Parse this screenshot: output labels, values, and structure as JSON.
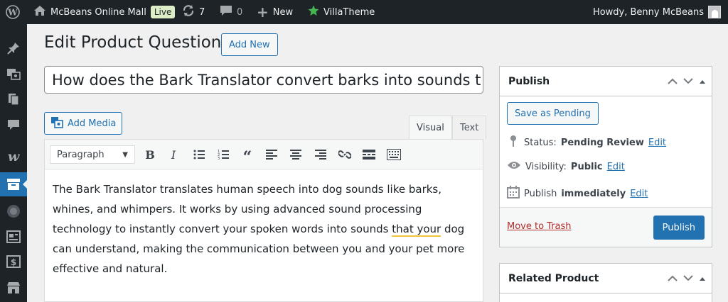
{
  "admin_bar": {
    "site_name": "McBeans Online Mall",
    "live_badge": "Live",
    "updates_count": "7",
    "comments_count": "0",
    "new_label": "New",
    "villatheme_label": "VillaTheme",
    "howdy": "Howdy, Benny McBeans"
  },
  "page": {
    "title": "Edit Product Question",
    "add_new_label": "Add New"
  },
  "post": {
    "title_value": "How does the Bark Translator convert barks into sounds t"
  },
  "editor": {
    "add_media_label": "Add Media",
    "tab_visual": "Visual",
    "tab_text": "Text",
    "format_value": "Paragraph",
    "content_part1": "The Bark Translator translates human speech into dog sounds like barks, whines, and whimpers. It works by using advanced sound processing technology to instantly convert your spoken words into sounds ",
    "content_spell": "that your",
    "content_part2": " dog can understand, making the communication between you and your pet more effective and natural."
  },
  "publish_box": {
    "title": "Publish",
    "save_pending_label": "Save as Pending",
    "status_label": "Status:",
    "status_value": "Pending Review",
    "visibility_label": "Visibility:",
    "visibility_value": "Public",
    "publish_label": "Publish",
    "publish_when": "immediately",
    "edit_label": "Edit",
    "trash_label": "Move to Trash",
    "publish_button": "Publish"
  },
  "related_box": {
    "title": "Related Product"
  },
  "colors": {
    "admin_bg": "#1d2327",
    "accent": "#2271b1",
    "live_badge_bg": "#dcedc8",
    "trash_red": "#b32d2e",
    "villatheme_star": "#46b450"
  }
}
